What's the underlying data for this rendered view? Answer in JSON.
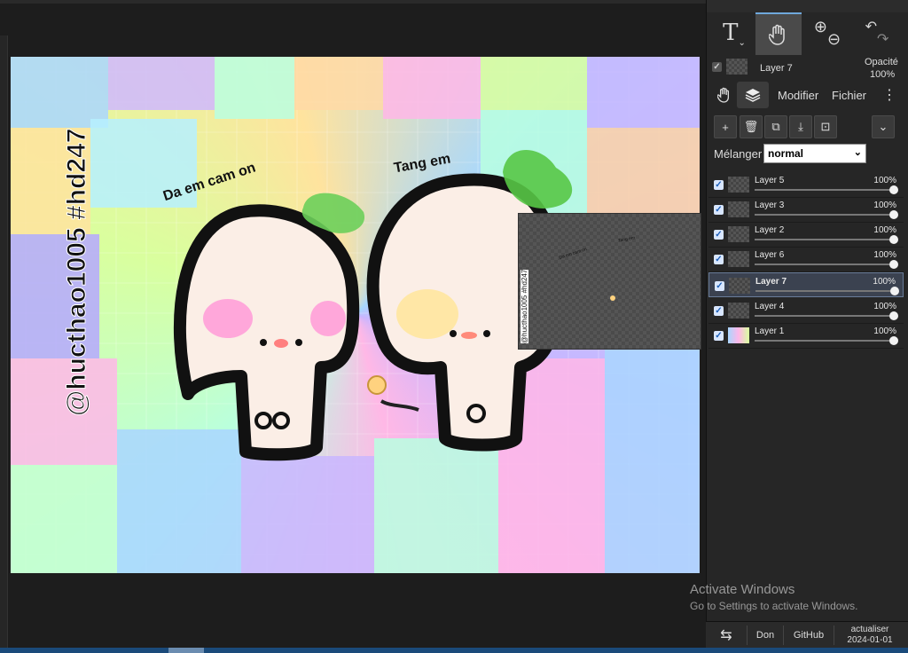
{
  "canvas": {
    "text_left_character": "Da em cam on",
    "text_right_character": "Tang em",
    "watermark": "@hucthao1005 #hd247"
  },
  "panel": {
    "tools": {
      "text": "T",
      "hand": "hand-icon",
      "zoom_in": "⊕",
      "zoom_out": "⊖",
      "undo": "undo-icon",
      "redo": "redo-icon"
    },
    "active_layer": {
      "name": "Layer 7",
      "opacity_label": "Opacité",
      "opacity_value": "100%"
    },
    "tabs": {
      "modifier": "Modifier",
      "fichier": "Fichier"
    },
    "blend": {
      "label": "Mélanger",
      "value": "normal"
    },
    "layers": [
      {
        "name": "Layer 5",
        "opacity": "100%"
      },
      {
        "name": "Layer 3",
        "opacity": "100%"
      },
      {
        "name": "Layer 2",
        "opacity": "100%"
      },
      {
        "name": "Layer 6",
        "opacity": "100%"
      },
      {
        "name": "Layer 7",
        "opacity": "100%"
      },
      {
        "name": "Layer 4",
        "opacity": "100%"
      },
      {
        "name": "Layer 1",
        "opacity": "100%"
      }
    ]
  },
  "windows_notice": {
    "title": "Activate Windows",
    "subtitle": "Go to Settings to activate Windows."
  },
  "footer": {
    "don": "Don",
    "github": "GitHub",
    "update_label": "actualiser",
    "update_date": "2024-01-01"
  }
}
